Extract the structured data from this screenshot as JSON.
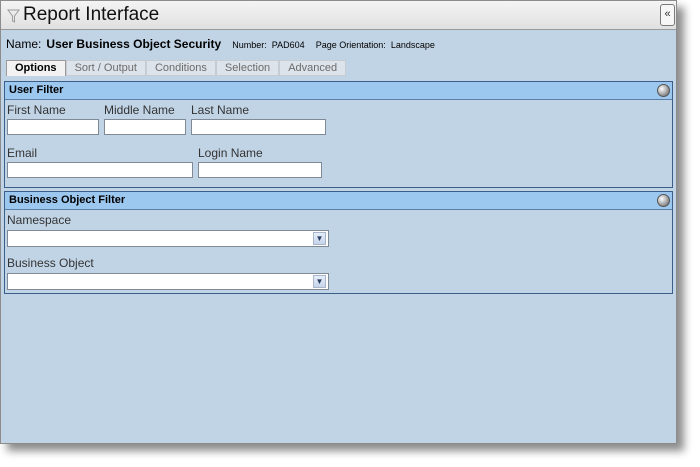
{
  "window": {
    "title": "Report Interface",
    "collapse_label": "«"
  },
  "report": {
    "name_label": "Name:",
    "name_value": "User Business Object Security",
    "number_label": "Number:",
    "number_value": "PAD604",
    "orientation_label": "Page Orientation:",
    "orientation_value": "Landscape"
  },
  "tabs": [
    {
      "label": "Options",
      "active": true
    },
    {
      "label": "Sort / Output",
      "active": false
    },
    {
      "label": "Conditions",
      "active": false
    },
    {
      "label": "Selection",
      "active": false
    },
    {
      "label": "Advanced",
      "active": false
    }
  ],
  "user_filter": {
    "title": "User Filter",
    "first_name": {
      "label": "First Name",
      "value": ""
    },
    "middle_name": {
      "label": "Middle Name",
      "value": ""
    },
    "last_name": {
      "label": "Last Name",
      "value": ""
    },
    "email": {
      "label": "Email",
      "value": ""
    },
    "login_name": {
      "label": "Login Name",
      "value": ""
    }
  },
  "business_object_filter": {
    "title": "Business Object Filter",
    "namespace": {
      "label": "Namespace",
      "selected": ""
    },
    "business_object": {
      "label": "Business Object",
      "selected": ""
    }
  },
  "icons": {
    "panel_toggle": "collapse-circle-icon",
    "title": "funnel-icon",
    "dropdown": "chevron-down-icon"
  }
}
